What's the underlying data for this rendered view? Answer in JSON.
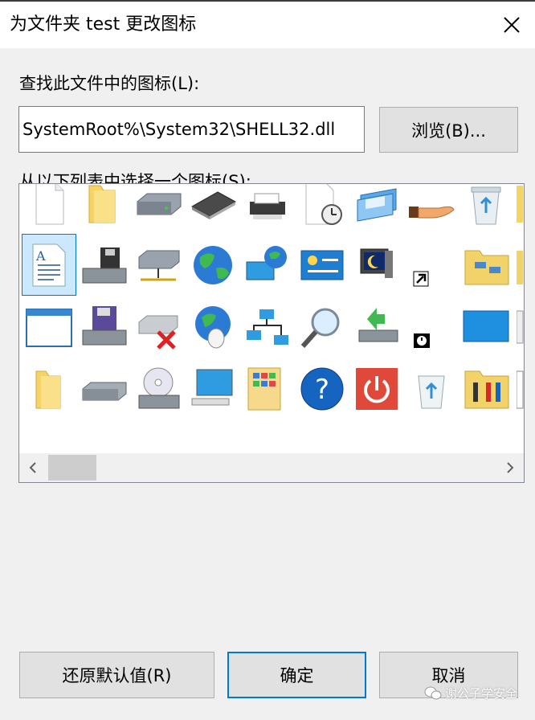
{
  "window": {
    "title": "为文件夹 test 更改图标"
  },
  "path_label": "查找此文件中的图标(L):",
  "path_value": "SystemRoot%\\System32\\SHELL32.dll",
  "browse_label": "浏览(B)...",
  "list_label": "从以下列表中选择一个图标(S):",
  "icons": [
    "blank-document-icon",
    "folder-icon",
    "hard-drive-icon",
    "memory-chip-icon",
    "printer-icon",
    "scheduled-document-icon",
    "window-stack-icon",
    "hand-sharing-icon",
    "recycle-bin-full-icon",
    "text-document-icon",
    "floppy-drive-icon",
    "network-drive-icon",
    "globe-icon",
    "network-globe-icon",
    "control-panel-icon",
    "screen-saver-icon",
    "shortcut-arrow-icon",
    "network-folder-icon",
    "application-window-icon",
    "floppy-disk-icon",
    "disconnected-drive-icon",
    "globe-mouse-icon",
    "network-connection-icon",
    "search-icon",
    "safely-remove-icon",
    "clock-overlay-icon",
    "desktop-icon",
    "folder-icon",
    "removable-drive-icon",
    "cd-drive-icon",
    "computer-icon",
    "picture-folder-icon",
    "help-icon",
    "power-icon",
    "recycle-bin-empty-icon",
    "tools-folder-icon"
  ],
  "buttons": {
    "restore": "还原默认值(R)",
    "ok": "确定",
    "cancel": "取消"
  },
  "watermark": "谢公子学安全",
  "colors": {
    "accent": "#0078d7",
    "selection": "#cce8ff"
  }
}
